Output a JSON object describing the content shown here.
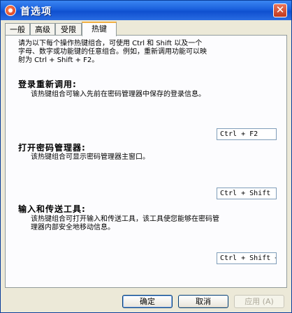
{
  "window": {
    "title": "首选项",
    "close_glyph": "✕"
  },
  "tabs": [
    {
      "label": "一般"
    },
    {
      "label": "高级"
    },
    {
      "label": "受限"
    },
    {
      "label": "热键",
      "active": true
    }
  ],
  "intro": {
    "line1": "请为以下每个操作热键组合，可使用 Ctrl 和 Shift 以及一个",
    "line2": "字母、数字或功能键的任意组合。例如，重新调用功能可以映",
    "line3": "射为 Ctrl + Shift + F2。"
  },
  "sections": [
    {
      "title": "登录重新调用:",
      "description_line1": "该热键组合可输入先前在密码管理器中保存的登录信息。",
      "description_line2": "",
      "hotkey_value": "Ctrl + F2"
    },
    {
      "title": "打开密码管理器:",
      "description_line1": "该热键组合可显示密码管理器主窗口。",
      "description_line2": "",
      "hotkey_value": "Ctrl + Shift"
    },
    {
      "title": "输入和传送工具:",
      "description_line1": "该热键组合可打开输入和传送工具，该工具使您能够在密码管",
      "description_line2": "理器内部安全地移动信息。",
      "hotkey_value": "Ctrl + Shift +"
    }
  ],
  "buttons": {
    "ok": "确定",
    "cancel": "取消",
    "apply": "应用 (A)"
  }
}
